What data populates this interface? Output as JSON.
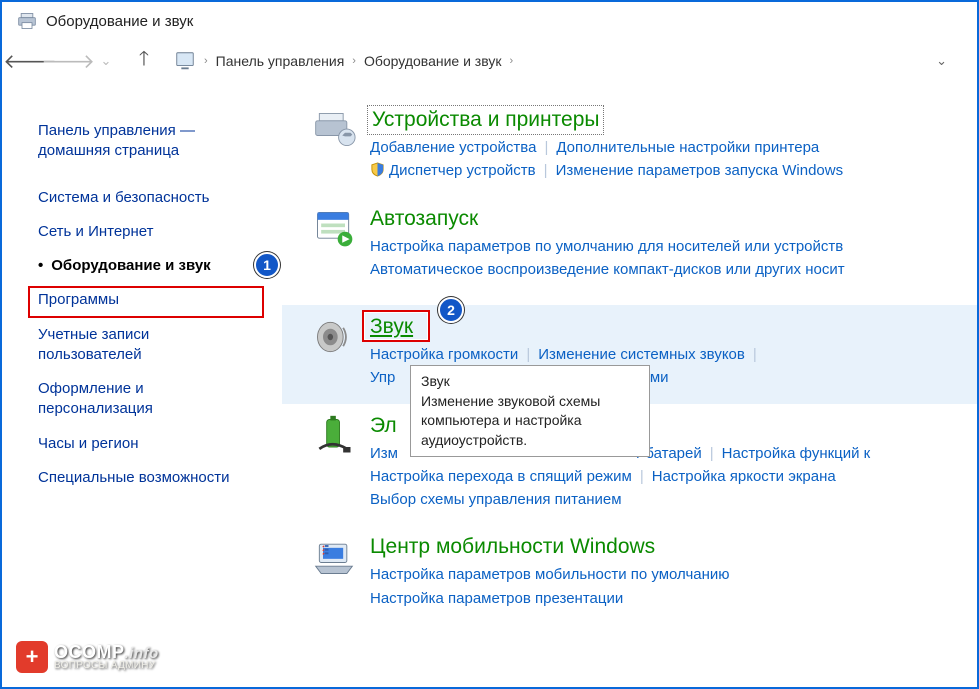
{
  "window": {
    "title": "Оборудование и звук"
  },
  "nav": {
    "breadcrumb": [
      "Панель управления",
      "Оборудование и звук"
    ]
  },
  "sidebar": {
    "items": [
      "Панель управления — домашняя страница",
      "Система и безопасность",
      "Сеть и Интернет",
      "Оборудование и звук",
      "Программы",
      "Учетные записи пользователей",
      "Оформление и персонализация",
      "Часы и регион",
      "Специальные возможности"
    ],
    "active_index": 3
  },
  "annotations": {
    "badge1": "1",
    "badge2": "2"
  },
  "categories": [
    {
      "title": "Устройства и принтеры",
      "links": [
        [
          "Добавление устройства",
          "Дополнительные настройки принтера"
        ],
        [
          "Диспетчер устройств",
          "Изменение параметров запуска Windows"
        ]
      ],
      "shield_on": [
        1
      ]
    },
    {
      "title": "Автозапуск",
      "links": [
        [
          "Настройка параметров по умолчанию для носителей или устройств"
        ],
        [
          "Автоматическое воспроизведение компакт-дисков или других носит"
        ]
      ]
    },
    {
      "title": "Звук",
      "links": [
        [
          "Настройка громкости",
          "Изменение системных звуков"
        ],
        [
          "Упр",
          "вами"
        ]
      ]
    },
    {
      "title": "Эл",
      "links_left": "Изм",
      "links": [
        [
          "т батарей",
          "Настройка функций к"
        ],
        [
          "Настройка перехода в спящий режим",
          "Настройка яркости экрана"
        ],
        [
          "Выбор схемы управления питанием"
        ]
      ]
    },
    {
      "title": "Центр мобильности Windows",
      "links": [
        [
          "Настройка параметров мобильности по умолчанию"
        ],
        [
          "Настройка параметров презентации"
        ]
      ]
    }
  ],
  "tooltip": {
    "title": "Звук",
    "body": "Изменение звуковой схемы компьютера и настройка аудиоустройств."
  },
  "watermark": {
    "main": "OCOMP",
    "suffix": ".info",
    "sub": "ВОПРОСЫ АДМИНУ"
  }
}
